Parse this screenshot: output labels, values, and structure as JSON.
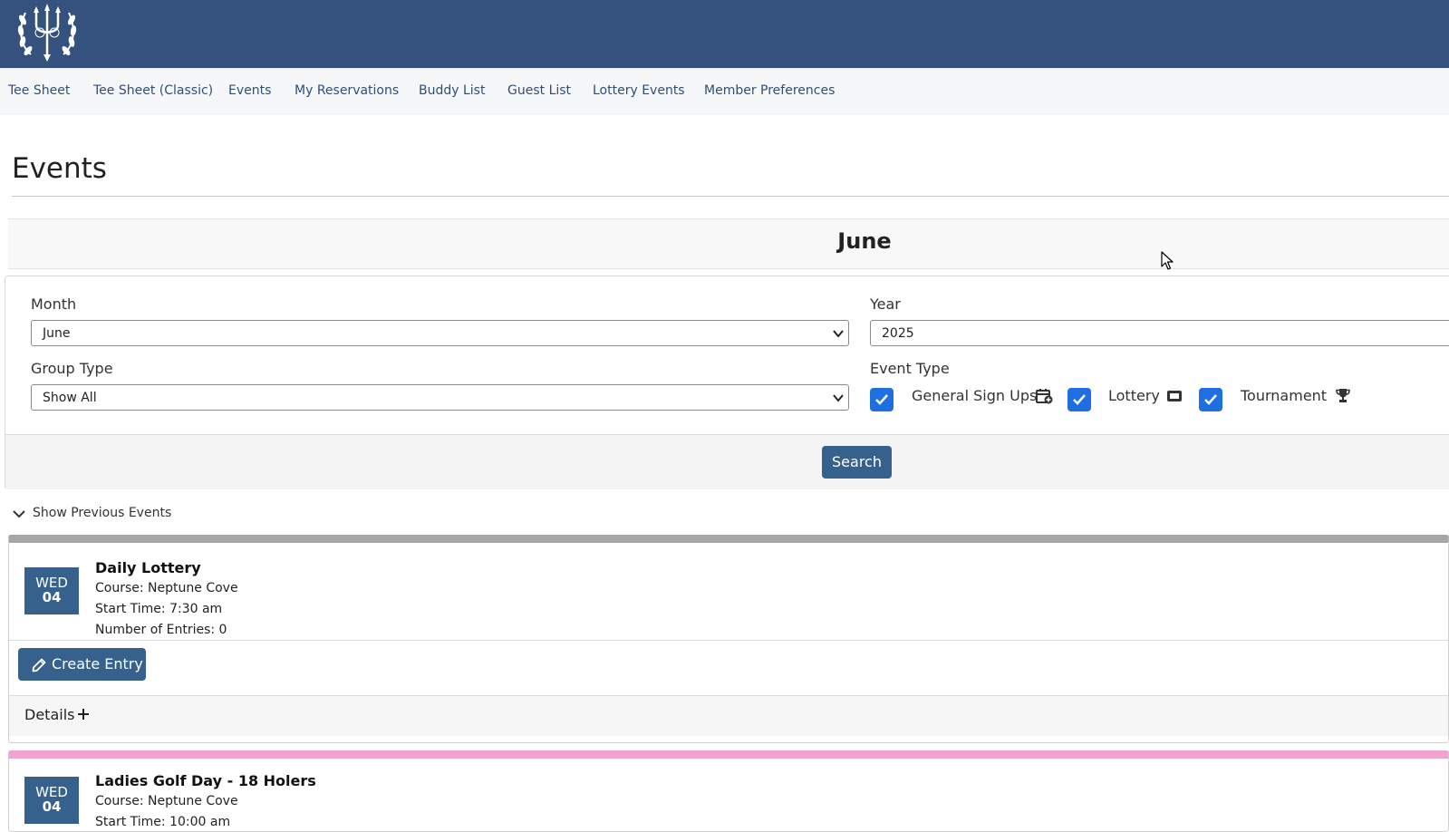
{
  "nav": {
    "items": [
      {
        "label": "Tee Sheet"
      },
      {
        "label": "Tee Sheet (Classic)"
      },
      {
        "label": "Events"
      },
      {
        "label": "My Reservations"
      },
      {
        "label": "Buddy List"
      },
      {
        "label": "Guest List"
      },
      {
        "label": "Lottery Events"
      },
      {
        "label": "Member Preferences"
      }
    ]
  },
  "page": {
    "title": "Events",
    "month_heading": "June"
  },
  "filters": {
    "month_label": "Month",
    "month_value": "June",
    "year_label": "Year",
    "year_value": "2025",
    "group_type_label": "Group Type",
    "group_type_value": "Show All",
    "event_type_label": "Event Type",
    "event_types": [
      {
        "label": "General Sign Ups",
        "checked": true,
        "icon": "calendar-plus-icon"
      },
      {
        "label": "Lottery",
        "checked": true,
        "icon": "ticket-icon"
      },
      {
        "label": "Tournament",
        "checked": true,
        "icon": "trophy-icon"
      }
    ],
    "search_label": "Search"
  },
  "previous_toggle": "Show Previous Events",
  "events": [
    {
      "dow": "WED",
      "day": "04",
      "title": "Daily Lottery",
      "course": "Course: Neptune Cove",
      "start_time": "Start Time: 7:30 am",
      "entries": "Number of Entries: 0",
      "create_label": "Create Entry",
      "details_label": "Details",
      "accent": "#a6a6a6"
    },
    {
      "dow": "WED",
      "day": "04",
      "title": "Ladies Golf Day - 18 Holers",
      "course": "Course: Neptune Cove",
      "start_time": "Start Time: 10:00 am",
      "accent": "#f0a4cf"
    }
  ],
  "colors": {
    "header": "#35527f",
    "primary_button": "#36618d",
    "checkbox": "#1f6fe0"
  }
}
